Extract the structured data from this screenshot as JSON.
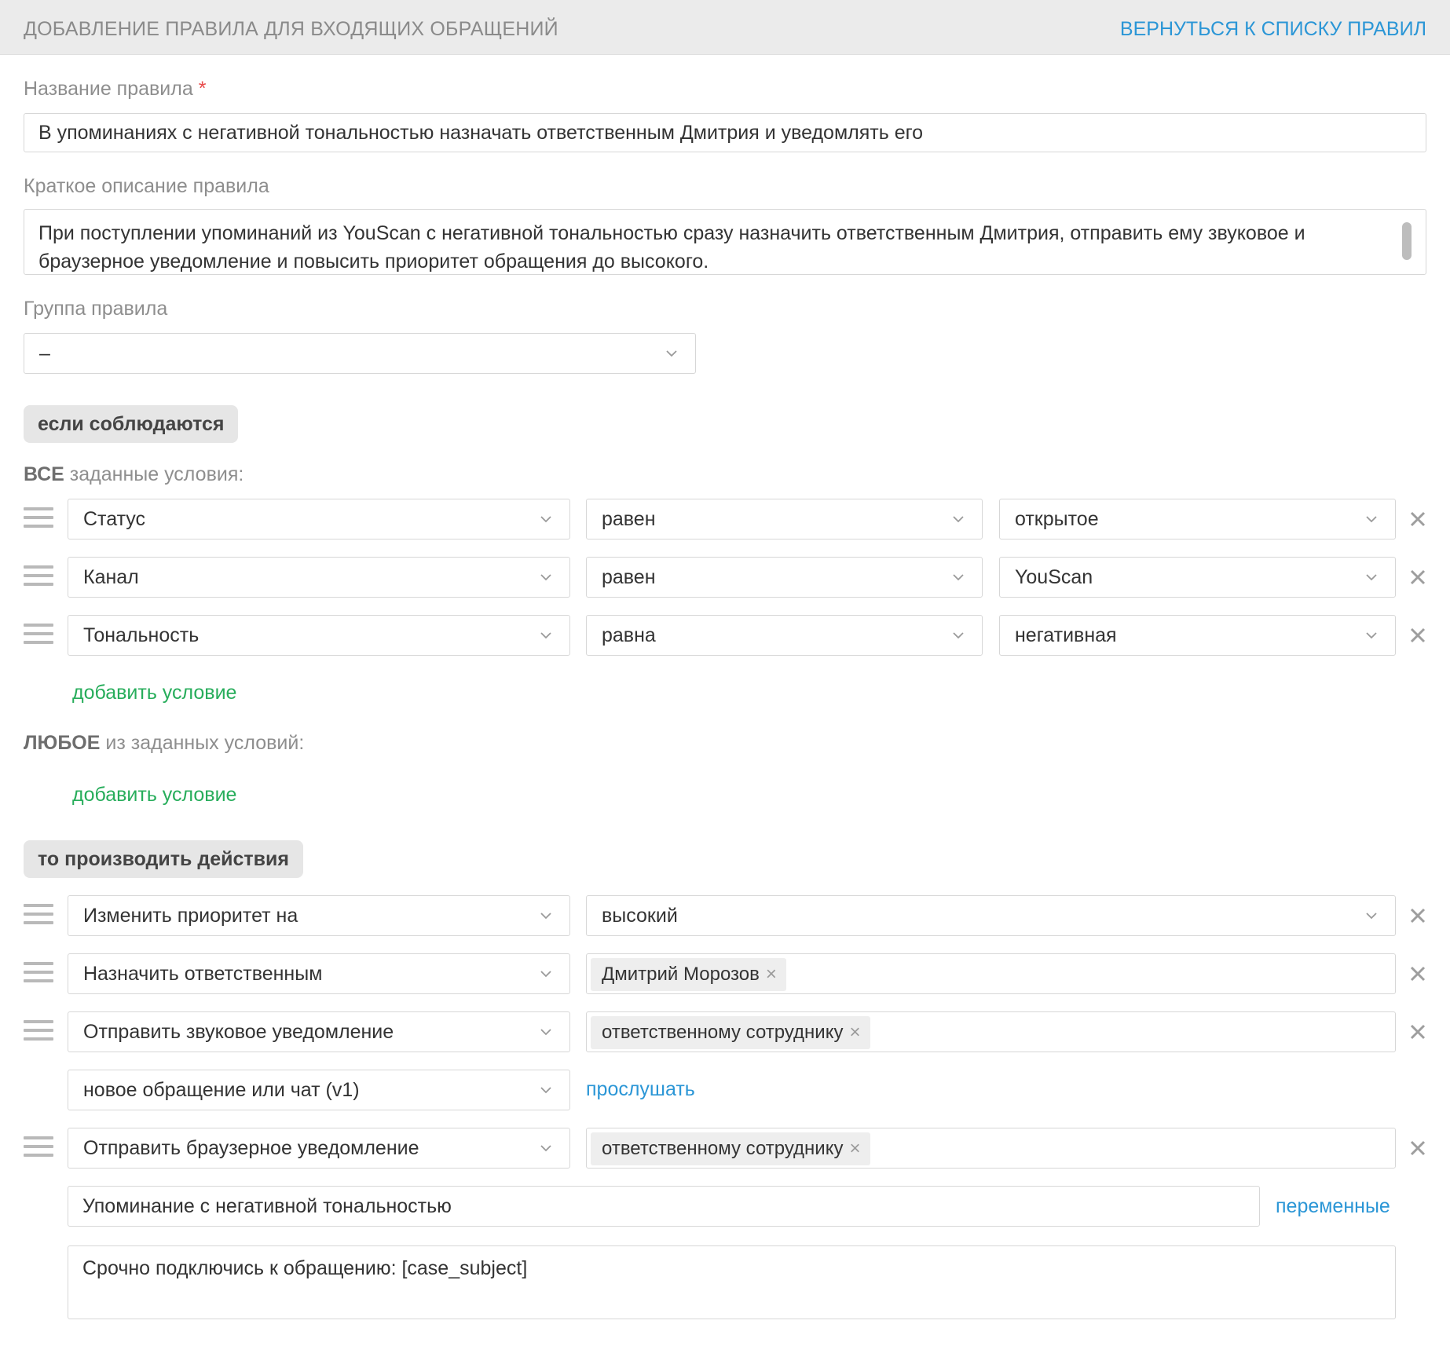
{
  "header": {
    "title": "ДОБАВЛЕНИЕ ПРАВИЛА ДЛЯ ВХОДЯЩИХ ОБРАЩЕНИЙ",
    "back_link": "ВЕРНУТЬСЯ К СПИСКУ ПРАВИЛ"
  },
  "rule_name": {
    "label": "Название правила",
    "required_mark": "*",
    "value": "В упоминаниях с негативной тональностью назначать ответственным Дмитрия и уведомлять его"
  },
  "description": {
    "label": "Краткое описание правила",
    "value": "При поступлении упоминаний из YouScan с негативной тональностью сразу назначить ответственным Дмитрия, отправить ему звуковое и браузерное уведомление и повысить приоритет обращения до высокого."
  },
  "group": {
    "label": "Группа правила",
    "value": "–"
  },
  "conditions": {
    "section_label": "если соблюдаются",
    "all_keyword": "ВСЕ",
    "all_text": "заданные условия:",
    "all_rows": [
      {
        "field": "Статус",
        "operator": "равен",
        "value": "открытое"
      },
      {
        "field": "Канал",
        "operator": "равен",
        "value": "YouScan"
      },
      {
        "field": "Тональность",
        "operator": "равна",
        "value": "негативная"
      }
    ],
    "add_condition": "добавить условие",
    "any_keyword": "ЛЮБОЕ",
    "any_text": "из заданных условий:",
    "add_condition_any": "добавить условие"
  },
  "actions": {
    "section_label": "то производить действия",
    "priority": {
      "action": "Изменить приоритет на",
      "value": "высокий"
    },
    "assign": {
      "action": "Назначить ответственным",
      "tag": "Дмитрий Морозов"
    },
    "sound": {
      "action": "Отправить звуковое уведомление",
      "tag": "ответственному сотруднику",
      "sound_value": "новое обращение или чат (v1)",
      "listen_link": "прослушать"
    },
    "browser": {
      "action": "Отправить браузерное уведомление",
      "tag": "ответственному сотруднику",
      "subject": "Упоминание с негативной тональностью",
      "variables_link": "переменные",
      "body": "Срочно подключись к обращению: [case_subject]"
    }
  },
  "icons": {
    "drag": "drag-handle-icon",
    "close": "close-icon",
    "chevron": "chevron-down-icon",
    "tag_remove": "×"
  }
}
